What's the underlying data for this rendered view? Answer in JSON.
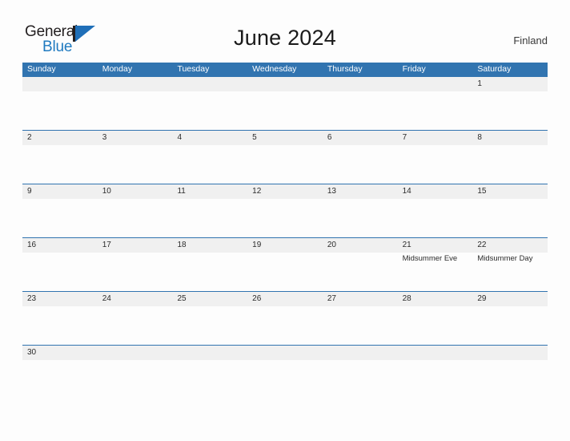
{
  "brand": {
    "name_part1": "General",
    "name_part2": "Blue",
    "mark_icon": "triangle-logo-icon",
    "color_primary": "#1f6fb8",
    "color_text": "#231f20"
  },
  "header": {
    "title": "June 2024",
    "country": "Finland"
  },
  "calendar": {
    "header_bg": "#3174b0",
    "number_band_bg": "#f0f0f0",
    "rule_color": "#3174b0",
    "day_names": [
      "Sunday",
      "Monday",
      "Tuesday",
      "Wednesday",
      "Thursday",
      "Friday",
      "Saturday"
    ],
    "weeks": [
      {
        "days": [
          {
            "number": "",
            "event": ""
          },
          {
            "number": "",
            "event": ""
          },
          {
            "number": "",
            "event": ""
          },
          {
            "number": "",
            "event": ""
          },
          {
            "number": "",
            "event": ""
          },
          {
            "number": "",
            "event": ""
          },
          {
            "number": "1",
            "event": ""
          }
        ]
      },
      {
        "days": [
          {
            "number": "2",
            "event": ""
          },
          {
            "number": "3",
            "event": ""
          },
          {
            "number": "4",
            "event": ""
          },
          {
            "number": "5",
            "event": ""
          },
          {
            "number": "6",
            "event": ""
          },
          {
            "number": "7",
            "event": ""
          },
          {
            "number": "8",
            "event": ""
          }
        ]
      },
      {
        "days": [
          {
            "number": "9",
            "event": ""
          },
          {
            "number": "10",
            "event": ""
          },
          {
            "number": "11",
            "event": ""
          },
          {
            "number": "12",
            "event": ""
          },
          {
            "number": "13",
            "event": ""
          },
          {
            "number": "14",
            "event": ""
          },
          {
            "number": "15",
            "event": ""
          }
        ]
      },
      {
        "days": [
          {
            "number": "16",
            "event": ""
          },
          {
            "number": "17",
            "event": ""
          },
          {
            "number": "18",
            "event": ""
          },
          {
            "number": "19",
            "event": ""
          },
          {
            "number": "20",
            "event": ""
          },
          {
            "number": "21",
            "event": "Midsummer Eve"
          },
          {
            "number": "22",
            "event": "Midsummer Day"
          }
        ]
      },
      {
        "days": [
          {
            "number": "23",
            "event": ""
          },
          {
            "number": "24",
            "event": ""
          },
          {
            "number": "25",
            "event": ""
          },
          {
            "number": "26",
            "event": ""
          },
          {
            "number": "27",
            "event": ""
          },
          {
            "number": "28",
            "event": ""
          },
          {
            "number": "29",
            "event": ""
          }
        ]
      },
      {
        "days": [
          {
            "number": "30",
            "event": ""
          },
          {
            "number": "",
            "event": ""
          },
          {
            "number": "",
            "event": ""
          },
          {
            "number": "",
            "event": ""
          },
          {
            "number": "",
            "event": ""
          },
          {
            "number": "",
            "event": ""
          },
          {
            "number": "",
            "event": ""
          }
        ]
      }
    ]
  }
}
